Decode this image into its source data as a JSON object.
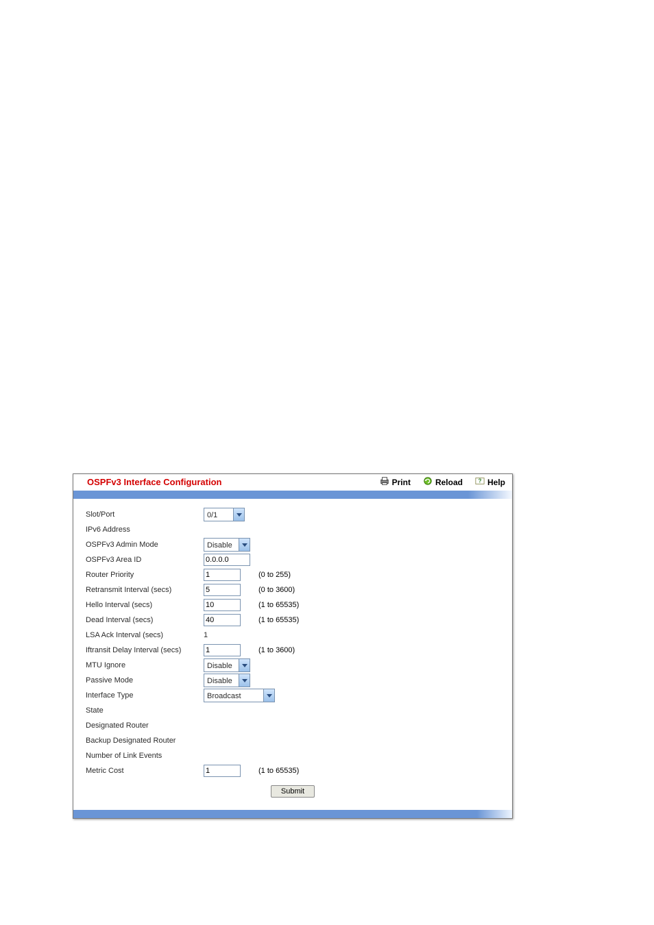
{
  "header": {
    "title": "OSPFv3 Interface Configuration",
    "links": {
      "print": "Print",
      "reload": "Reload",
      "help": "Help"
    }
  },
  "form": {
    "slot_port": {
      "label": "Slot/Port",
      "value": "0/1"
    },
    "ipv6_addr": {
      "label": "IPv6 Address",
      "value": ""
    },
    "admin_mode": {
      "label": "OSPFv3 Admin Mode",
      "value": "Disable"
    },
    "area_id": {
      "label": "OSPFv3 Area ID",
      "value": "0.0.0.0"
    },
    "router_priority": {
      "label": "Router Priority",
      "value": "1",
      "range": "(0 to 255)"
    },
    "retransmit": {
      "label": "Retransmit Interval (secs)",
      "value": "5",
      "range": "(0 to 3600)"
    },
    "hello": {
      "label": "Hello Interval (secs)",
      "value": "10",
      "range": "(1 to 65535)"
    },
    "dead": {
      "label": "Dead Interval (secs)",
      "value": "40",
      "range": "(1 to 65535)"
    },
    "lsa_ack": {
      "label": "LSA Ack Interval (secs)",
      "value": "1"
    },
    "iftransit": {
      "label": "Iftransit Delay Interval (secs)",
      "value": "1",
      "range": "(1 to 3600)"
    },
    "mtu_ignore": {
      "label": "MTU Ignore",
      "value": "Disable"
    },
    "passive_mode": {
      "label": "Passive Mode",
      "value": "Disable"
    },
    "interface_type": {
      "label": "Interface Type",
      "value": "Broadcast"
    },
    "state": {
      "label": "State",
      "value": ""
    },
    "designated": {
      "label": "Designated Router",
      "value": ""
    },
    "backup": {
      "label": "Backup Designated Router",
      "value": ""
    },
    "link_events": {
      "label": "Number of Link Events",
      "value": ""
    },
    "metric": {
      "label": "Metric Cost",
      "value": "1",
      "range": "(1 to 65535)"
    }
  },
  "buttons": {
    "submit": "Submit"
  }
}
